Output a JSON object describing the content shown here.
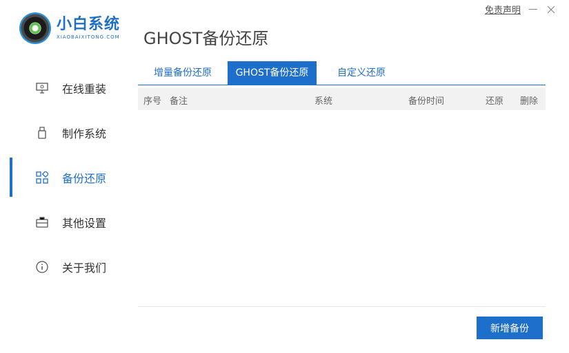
{
  "app": {
    "logo_title": "小白系统",
    "logo_subtitle": "XIAOBAIXITONG.COM",
    "page_title": "GHOST备份还原",
    "disclaimer": "免责声明"
  },
  "sidebar": {
    "items": [
      {
        "label": "在线重装",
        "icon": "monitor-icon"
      },
      {
        "label": "制作系统",
        "icon": "usb-drive-icon"
      },
      {
        "label": "备份还原",
        "icon": "grid-icon",
        "active": true
      },
      {
        "label": "其他设置",
        "icon": "toolbox-icon"
      },
      {
        "label": "关于我们",
        "icon": "info-icon"
      }
    ]
  },
  "tabs": [
    {
      "label": "增量备份还原"
    },
    {
      "label": "GHOST备份还原",
      "active": true
    },
    {
      "label": "自定义还原"
    }
  ],
  "table": {
    "columns": [
      "序号",
      "备注",
      "系统",
      "备份时间",
      "还原",
      "删除"
    ],
    "rows": []
  },
  "actions": {
    "new_backup": "新增备份"
  },
  "colors": {
    "accent": "#1e6ecb",
    "header_bg": "#f2f2f2"
  }
}
